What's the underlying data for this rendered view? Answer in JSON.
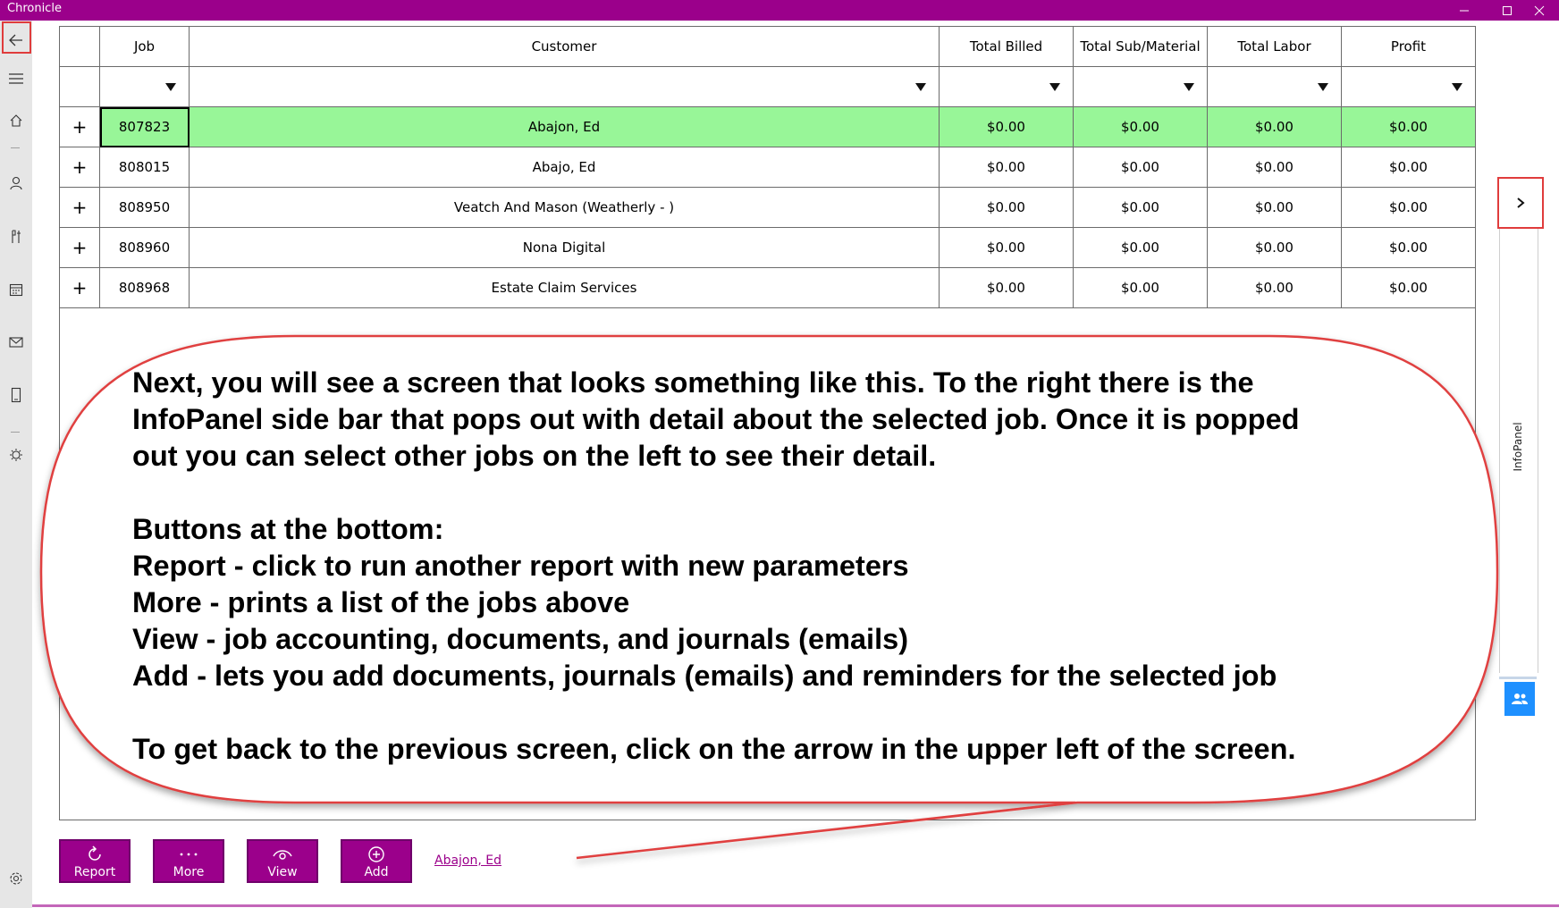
{
  "window": {
    "title": "Chronicle"
  },
  "nav": {
    "back": "back-arrow-icon",
    "items": [
      "menu-icon",
      "home-icon",
      "person-icon",
      "tools-icon",
      "calendar-icon",
      "mail-icon",
      "tablet-icon",
      "bug-icon",
      "settings-icon"
    ]
  },
  "table": {
    "columns": [
      "",
      "Job",
      "Customer",
      "Total Billed",
      "Total Sub/Material",
      "Total Labor",
      "Profit"
    ],
    "expander": "+",
    "rows": [
      {
        "job": "807823",
        "customer": "Abajon, Ed",
        "billed": "$0.00",
        "sub": "$0.00",
        "labor": "$0.00",
        "profit": "$0.00",
        "selected": true
      },
      {
        "job": "808015",
        "customer": "Abajo, Ed",
        "billed": "$0.00",
        "sub": "$0.00",
        "labor": "$0.00",
        "profit": "$0.00"
      },
      {
        "job": "808950",
        "customer": "Veatch And Mason (Weatherly - )",
        "billed": "$0.00",
        "sub": "$0.00",
        "labor": "$0.00",
        "profit": "$0.00"
      },
      {
        "job": "808960",
        "customer": "Nona Digital",
        "billed": "$0.00",
        "sub": "$0.00",
        "labor": "$0.00",
        "profit": "$0.00"
      },
      {
        "job": "808968",
        "customer": "Estate Claim Services",
        "billed": "$0.00",
        "sub": "$0.00",
        "labor": "$0.00",
        "profit": "$0.00"
      }
    ]
  },
  "callout": {
    "lines": [
      "Next, you will see a screen that looks something like this. To the right there is the",
      "InfoPanel side bar that pops out with detail about the selected job. Once it is popped",
      "out you can select other jobs on the left to see their detail.",
      "",
      "Buttons at the bottom:",
      "Report - click to run another report with new parameters",
      "More - prints a list of the jobs above",
      "View - job accounting, documents, and journals (emails)",
      "Add - lets you add documents, journals (emails) and reminders for the selected job",
      "",
      "To get back to the previous screen, click on the arrow in the upper left of the screen."
    ]
  },
  "infopanel": {
    "label": "InfoPanel"
  },
  "actions": {
    "report": "Report",
    "more": "More",
    "view": "View",
    "add": "Add",
    "selected_customer": "Abajon, Ed"
  },
  "colors": {
    "accent": "#9b008b",
    "selected_row": "#98f698",
    "highlight": "#e03c3c",
    "info_button": "#1e90ff"
  }
}
